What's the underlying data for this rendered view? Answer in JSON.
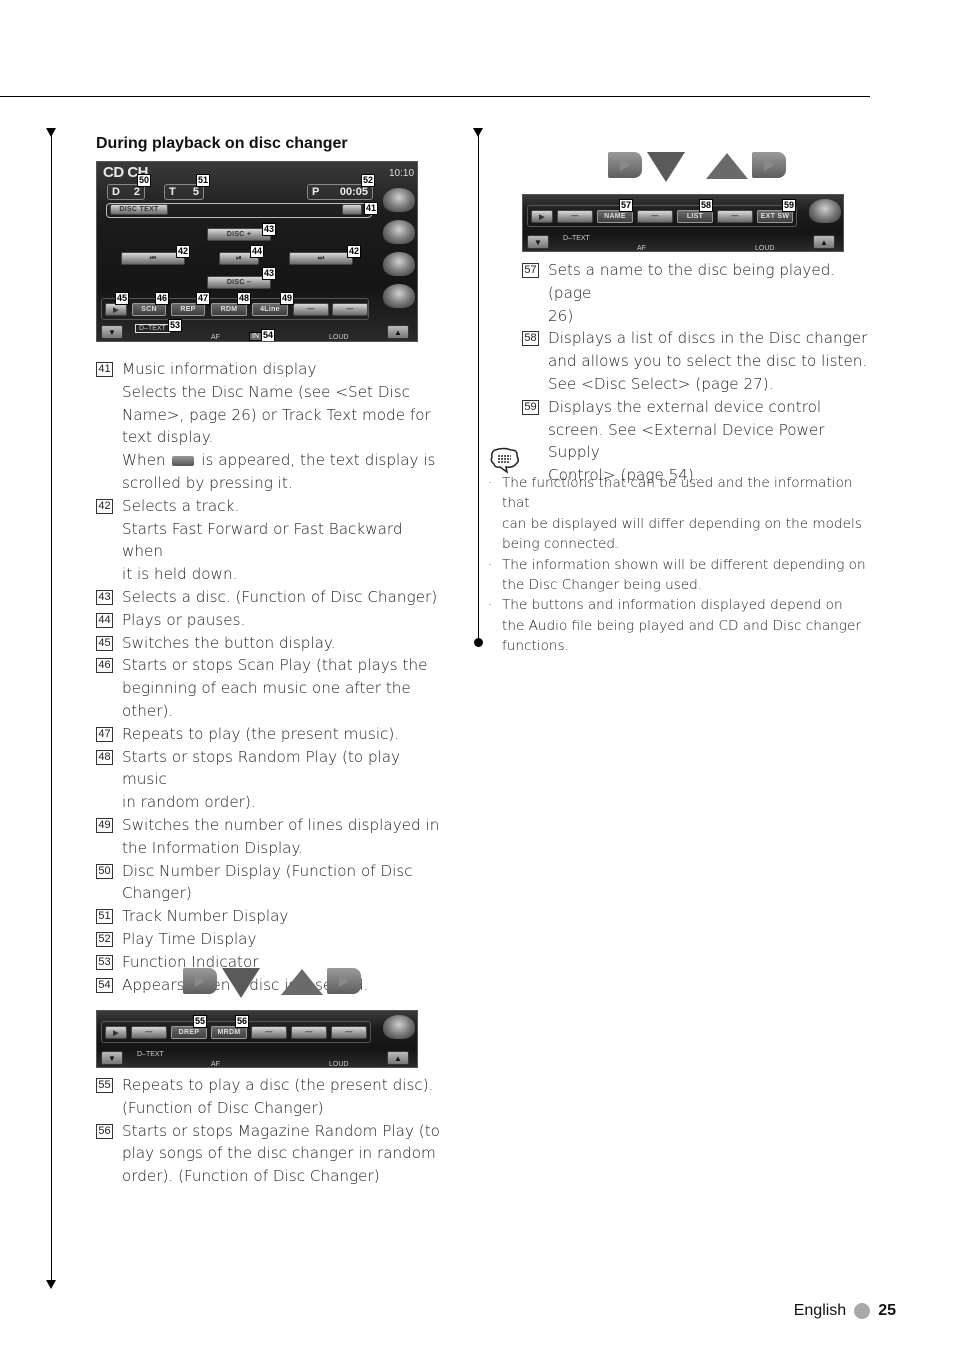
{
  "section_title": "During playback on disc changer",
  "main_screen": {
    "source_title": "CD CH",
    "clock": "10:10",
    "disc_field": {
      "label": "D",
      "value": "2"
    },
    "track_field": {
      "label": "T",
      "value": "5"
    },
    "time_field": {
      "label": "P",
      "value": "00:05"
    },
    "disc_text_button": "DISC TEXT",
    "disc_plus": "DISC +",
    "disc_minus": "DISC –",
    "prev_symbol": "⏮",
    "play_pause_symbol": "⏯",
    "next_symbol": "⏭",
    "function_buttons": [
      "SCN",
      "REP",
      "RDM",
      "4Line",
      "—",
      "—"
    ],
    "function_indicator": "D–TEXT",
    "in_indicator": "IN",
    "af_label": "AF",
    "loud_label": "LOUD",
    "side_icons": [
      "menu-grid-icon",
      "media-icon",
      "speaker-icon",
      "satellite-icon"
    ],
    "callouts": {
      "c41": "41",
      "c42a": "42",
      "c42b": "42",
      "c43a": "43",
      "c43b": "43",
      "c44": "44",
      "c45": "45",
      "c46": "46",
      "c47": "47",
      "c48": "48",
      "c49": "49",
      "c50": "50",
      "c51": "51",
      "c52": "52",
      "c53": "53",
      "c54": "54"
    }
  },
  "descriptions_left": [
    {
      "num": "41",
      "lines": [
        "Music information display",
        "Selects the Disc Name (see <Set Disc",
        "Name>, page 26) or Track Text mode for",
        "text display."
      ],
      "extra_before": "When",
      "extra_after": "is appeared, the text display is",
      "extra_tail": "scrolled by pressing it."
    },
    {
      "num": "42",
      "lines": [
        "Selects a track.",
        "Starts Fast Forward or Fast Backward when",
        "it is held down."
      ]
    },
    {
      "num": "43",
      "lines": [
        "Selects a disc. (Function of Disc Changer)"
      ]
    },
    {
      "num": "44",
      "lines": [
        "Plays or pauses."
      ]
    },
    {
      "num": "45",
      "lines": [
        "Switches the button display."
      ]
    },
    {
      "num": "46",
      "lines": [
        "Starts or stops Scan Play (that plays the",
        "beginning of each music one after the",
        "other)."
      ]
    },
    {
      "num": "47",
      "lines": [
        "Repeats to play (the present music)."
      ]
    },
    {
      "num": "48",
      "lines": [
        "Starts or stops Random Play (to play music",
        "in random order)."
      ]
    },
    {
      "num": "49",
      "lines": [
        "Switches the number of lines displayed in",
        "the Information Display."
      ]
    },
    {
      "num": "50",
      "lines": [
        "Disc Number Display (Function of Disc",
        "Changer)"
      ]
    },
    {
      "num": "51",
      "lines": [
        "Track Number Display"
      ]
    },
    {
      "num": "52",
      "lines": [
        "Play Time Display"
      ]
    },
    {
      "num": "53",
      "lines": [
        "Function Indicator"
      ]
    },
    {
      "num": "54",
      "lines": [
        "Appears when a disc is inserted."
      ]
    }
  ],
  "strip_2": {
    "buttons": [
      "—",
      "DREP",
      "MRDM",
      "—",
      "—",
      "—"
    ],
    "function_indicator": "D–TEXT",
    "af_label": "AF",
    "loud_label": "LOUD",
    "callouts": {
      "c55": "55",
      "c56": "56"
    }
  },
  "descriptions_strip_2": [
    {
      "num": "55",
      "lines": [
        "Repeats to play a disc (the present disc).",
        "(Function of Disc Changer)"
      ]
    },
    {
      "num": "56",
      "lines": [
        "Starts or stops Magazine Random Play (to",
        "play songs of the disc changer in random",
        "order). (Function of Disc Changer)"
      ]
    }
  ],
  "strip_3": {
    "buttons": [
      "—",
      "NAME",
      "—",
      "LIST",
      "—",
      "EXT SW"
    ],
    "function_indicator": "D–TEXT",
    "af_label": "AF",
    "loud_label": "LOUD",
    "callouts": {
      "c57": "57",
      "c58": "58",
      "c59": "59"
    }
  },
  "descriptions_right": [
    {
      "num": "57",
      "lines": [
        "Sets a name to the disc being played. (page",
        "26)"
      ]
    },
    {
      "num": "58",
      "lines": [
        "Displays a list of discs in the Disc changer",
        "and allows you to select the disc to listen.",
        "See <Disc Select> (page 27)."
      ]
    },
    {
      "num": "59",
      "lines": [
        "Displays the external device control",
        "screen. See <External Device Power Supply",
        "Control> (page 54)."
      ]
    }
  ],
  "notes": [
    [
      "The functions that can be used and the information that",
      "can be displayed will differ depending on the models",
      "being connected."
    ],
    [
      "The information shown will be different depending on",
      "the Disc Changer being used."
    ],
    [
      "The buttons and information displayed depend on",
      "the Audio file being played and CD and Disc changer",
      "functions."
    ]
  ],
  "footer": {
    "language": "English",
    "page": "25"
  }
}
